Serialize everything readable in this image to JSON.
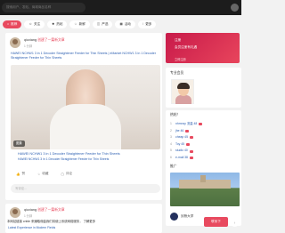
{
  "topbar": {
    "search_placeholder": "搜索用户、发帖、商城商品名称"
  },
  "tabs": [
    {
      "label": "推荐",
      "icon": "home-icon"
    },
    {
      "label": "关注",
      "icon": "user-icon"
    },
    {
      "label": "热帖",
      "icon": "fire-icon"
    },
    {
      "label": "新鲜",
      "icon": "star-icon"
    },
    {
      "label": "严选",
      "icon": "bag-icon"
    },
    {
      "label": "活动",
      "icon": "calendar-icon"
    },
    {
      "label": "更多",
      "icon": "grid-icon"
    }
  ],
  "post1": {
    "user": "qiuxiang",
    "badge": "创建了一篇新文章",
    "time": "1 分钟",
    "desc": "HAWEI NCHW1 3 in 1 Decoder Straightener Feeder for Thin Sheets | eMarket NCHW1 3 in 1 Decoder Straightener Feeder for Thin Sheets",
    "photo_tag": "图集",
    "title": "HAWEI NCHW1 3 in 1 Decoder Straightener Feeder for Thin Sheets",
    "subtitle": "HAWEI NCHW1 3 in 1 Decoder Straightener Feeder for Thin Sheets",
    "actions": {
      "like": "赞",
      "collect": "收藏",
      "comment": "评论"
    },
    "comment_placeholder": "写评论..."
  },
  "post2": {
    "user": "qiuxiang",
    "badge": "创建了一篇新文章",
    "time": "1 分钟",
    "text": "本网站链接 cnble 来赚取佣金我们将使上系统网络服务， 了解更多",
    "bottom": "Latest Experience in Modern Fields"
  },
  "promo": {
    "line1": "注册",
    "line2": "会员注册有礼遇",
    "line3": "立即注册"
  },
  "side1": {
    "header": "专业会员"
  },
  "side2": {
    "header": "热帖！",
    "items": [
      {
        "n": "1",
        "text": "nhmnxy 流量 48"
      },
      {
        "n": "2",
        "text": "jhe 46"
      },
      {
        "n": "3",
        "text": "cheap 45"
      },
      {
        "n": "4",
        "text": "Toy 45"
      },
      {
        "n": "5",
        "text": "studio 40"
      },
      {
        "n": "6",
        "text": "e-mail 38"
      }
    ]
  },
  "side3": {
    "header": "推广",
    "uni": "剑桥大学"
  },
  "fab": {
    "label": "联系下",
    "icon": "arrow-up-icon"
  }
}
